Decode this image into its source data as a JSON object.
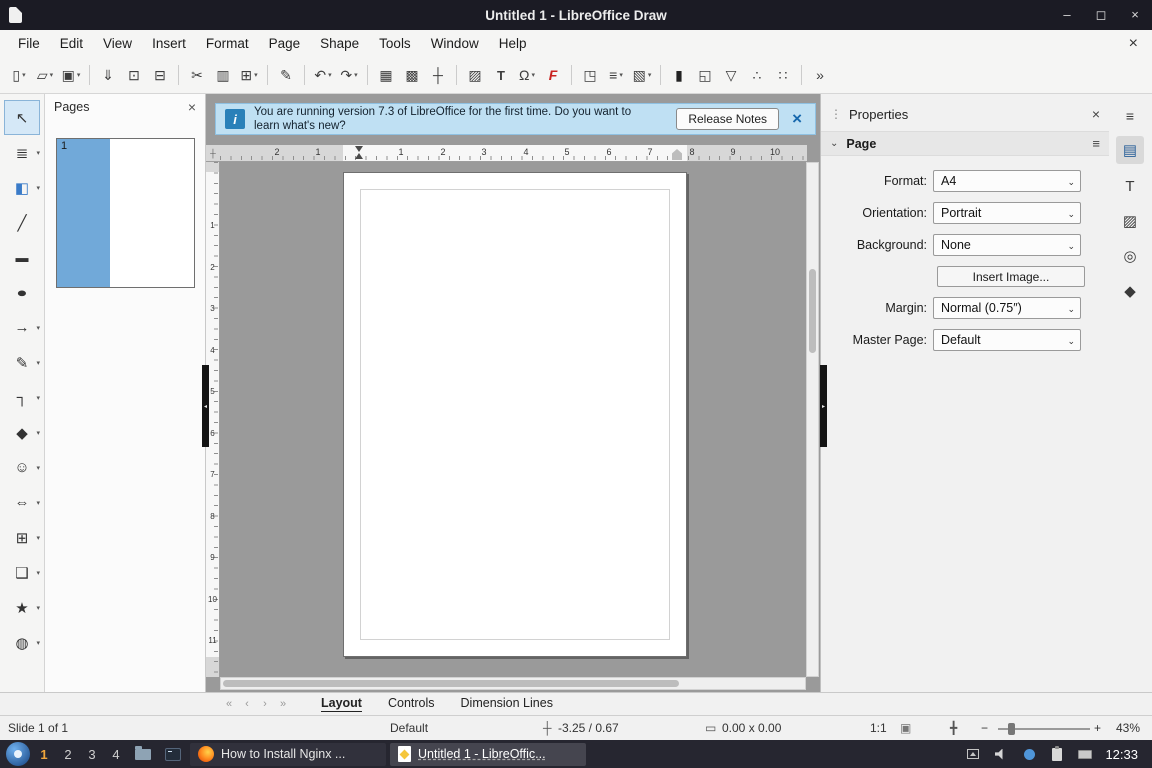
{
  "ui": {
    "caret": "▾",
    "chevron": "⌄",
    "close": "×",
    "hamburger": "≡",
    "dots": "⋮",
    "minimize": "–",
    "maximize": "◻",
    "cross": "┼"
  },
  "titlebar": {
    "title": "Untitled 1 - LibreOffice Draw"
  },
  "menubar": {
    "items": [
      "File",
      "Edit",
      "View",
      "Insert",
      "Format",
      "Page",
      "Shape",
      "Tools",
      "Window",
      "Help"
    ]
  },
  "toolbar": {
    "items": [
      {
        "name": "new-document",
        "glyph": "▯",
        "dropdown": true
      },
      {
        "name": "open-file",
        "glyph": "▱",
        "dropdown": true
      },
      {
        "name": "save",
        "glyph": "▣",
        "dropdown": true
      },
      {
        "name": "export-pdf",
        "glyph": "⇓"
      },
      {
        "name": "print-preview",
        "glyph": "⊡"
      },
      {
        "name": "print",
        "glyph": "⊟"
      },
      {
        "name": "cut",
        "glyph": "✂"
      },
      {
        "name": "copy",
        "glyph": "▥"
      },
      {
        "name": "paste",
        "glyph": "⊞",
        "dropdown": true
      },
      {
        "name": "clone-formatting",
        "glyph": "✎"
      },
      {
        "name": "undo",
        "glyph": "↶",
        "dropdown": true
      },
      {
        "name": "redo",
        "glyph": "↷",
        "dropdown": true
      },
      {
        "name": "display-grid",
        "glyph": "▦"
      },
      {
        "name": "snap-to-grid",
        "glyph": "▩"
      },
      {
        "name": "display-snap-guides",
        "glyph": "┼"
      },
      {
        "name": "insert-image",
        "glyph": "▨"
      },
      {
        "name": "insert-text-box",
        "glyph": "T"
      },
      {
        "name": "special-character",
        "glyph": "Ω",
        "dropdown": true
      },
      {
        "name": "fontwork",
        "glyph": "F"
      },
      {
        "name": "transformations",
        "glyph": "◳"
      },
      {
        "name": "align-objects",
        "glyph": "≡",
        "dropdown": true
      },
      {
        "name": "arrange",
        "glyph": "▧",
        "dropdown": true
      },
      {
        "name": "shadow",
        "glyph": "▮"
      },
      {
        "name": "crop-image",
        "glyph": "◱"
      },
      {
        "name": "filter",
        "glyph": "▽"
      },
      {
        "name": "edit-points",
        "glyph": "∴"
      },
      {
        "name": "glue-points",
        "glyph": "∷"
      },
      {
        "name": "overflow",
        "glyph": "»"
      }
    ]
  },
  "drawbar": {
    "items": [
      {
        "name": "select-tool",
        "glyph": "↖",
        "selected": true
      },
      {
        "name": "line-color",
        "glyph": "≣",
        "dropdown": true
      },
      {
        "name": "fill-color",
        "glyph": "◧",
        "dropdown": true
      },
      {
        "name": "insert-line",
        "glyph": "╱"
      },
      {
        "name": "rectangle-tool",
        "glyph": "▬"
      },
      {
        "name": "ellipse-tool",
        "glyph": "●"
      },
      {
        "name": "lines-arrows",
        "glyph": "→",
        "dropdown": true
      },
      {
        "name": "curves-polygons",
        "glyph": "✎",
        "dropdown": true
      },
      {
        "name": "connectors",
        "glyph": "┐",
        "dropdown": true
      },
      {
        "name": "basic-shapes",
        "glyph": "◆",
        "dropdown": true
      },
      {
        "name": "symbol-shapes",
        "glyph": "☺",
        "dropdown": true
      },
      {
        "name": "block-arrows",
        "glyph": "⇔",
        "dropdown": true
      },
      {
        "name": "flowchart-shapes",
        "glyph": "⊞",
        "dropdown": true
      },
      {
        "name": "callout-shapes",
        "glyph": "❑",
        "dropdown": true
      },
      {
        "name": "stars-banners",
        "glyph": "★",
        "dropdown": true
      },
      {
        "name": "3d-objects",
        "glyph": "◍",
        "dropdown": true
      }
    ]
  },
  "pages_panel": {
    "title": "Pages",
    "page_number": "1"
  },
  "infobar": {
    "icon_glyph": "i",
    "line1": "You are running version 7.3 of LibreOffice for the first time. Do you want to",
    "line2": "learn what's new?",
    "button_label": "Release Notes"
  },
  "rulers": {
    "h": [
      "2",
      "1",
      "1",
      "2",
      "3",
      "4",
      "5",
      "6",
      "7",
      "8",
      "9",
      "10"
    ],
    "v": [
      "1",
      "2",
      "3",
      "4",
      "5",
      "6",
      "7",
      "8",
      "9",
      "10",
      "11"
    ]
  },
  "sidebar": {
    "title": "Properties",
    "section_title": "Page",
    "rows": [
      {
        "label": "Format:",
        "value": "A4"
      },
      {
        "label": "Orientation:",
        "value": "Portrait"
      },
      {
        "label": "Background:",
        "value": "None"
      },
      {
        "label": "Margin:",
        "value": "Normal (0.75″)"
      },
      {
        "label": "Master Page:",
        "value": "Default"
      }
    ],
    "insert_image_label": "Insert Image...",
    "decks": [
      {
        "name": "properties-deck",
        "glyph": "▤",
        "active": true
      },
      {
        "name": "styles-deck",
        "glyph": "T"
      },
      {
        "name": "gallery-deck",
        "glyph": "▨"
      },
      {
        "name": "navigator-deck",
        "glyph": "◎"
      },
      {
        "name": "shapes-deck",
        "glyph": "◆"
      }
    ]
  },
  "tabbar": {
    "nav": [
      "«",
      "‹",
      "›",
      "»"
    ],
    "tabs": [
      "Layout",
      "Controls",
      "Dimension Lines"
    ],
    "active_tab": "Layout"
  },
  "statusbar": {
    "slide": "Slide 1 of 1",
    "layer": "Default",
    "position": "-3.25 / 0.67",
    "size": "0.00 x 0.00",
    "scale": "1:1",
    "zoom": "43%",
    "minus": "−",
    "plus": "+",
    "icons": {
      "position": "┼",
      "size": "▭",
      "modified": "▣",
      "fit": "╋"
    }
  },
  "taskbar": {
    "workspaces": [
      "1",
      "2",
      "3",
      "4"
    ],
    "windows": [
      {
        "title": "How to Install Nginx ..."
      },
      {
        "title": "Untitled 1 - LibreOffic...",
        "active": true
      }
    ],
    "clock": "12:33"
  },
  "colors": {
    "titlebar_bg": "#1b1b24",
    "canvas_gray": "#9a9a9a",
    "infobar_bg": "#bfe0f3",
    "selection_blue": "#71a9d9",
    "accent_blue": "#2980b9",
    "fontwork_red": "#c9211e",
    "workspace_active": "#f0a63c",
    "taskbar_bg": "#262630"
  }
}
